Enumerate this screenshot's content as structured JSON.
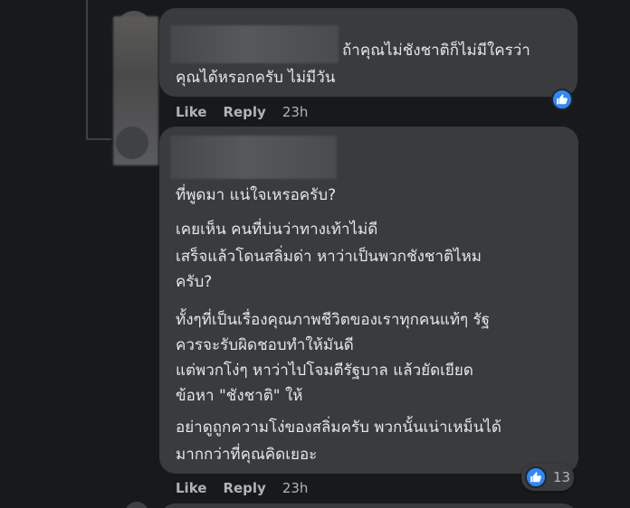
{
  "comment_1": {
    "author_redacted": true,
    "lines": [
      "ถ้าคุณไม่ชังชาติก็ไม่มีใครว่า",
      "คุณได้หรอกครับ ไม่มีวัน"
    ],
    "actions": {
      "like": "Like",
      "reply": "Reply",
      "time": "23h"
    }
  },
  "comment_2": {
    "author_redacted": true,
    "paragraphs": [
      [
        "ที่พูดมา แน่ใจเหรอครับ?"
      ],
      [
        "เคยเห็น คนที่บ่นว่าทางเท้าไม่ดี",
        "เสร็จแล้วโดนสลิ่มด่า หาว่าเป็นพวกชังชาติไหม",
        "ครับ?"
      ],
      [
        "ทั้งๆที่เป็นเรื่องคุณภาพชีวิตของเราทุกคนแท้ๆ รัฐ",
        "ควรจะรับผิดชอบทำให้มันดี",
        "แต่พวกโง่ๆ หาว่าไปโจมตีรัฐบาล แล้วยัดเยียด",
        "ข้อหา \"ชังชาติ\" ให้"
      ],
      [
        "อย่าดูถูกความโง่ของสลิ่มครับ พวกนั้นเน่าเหม็นได้",
        "มากกว่าที่คุณคิดเยอะ"
      ]
    ],
    "reaction_count": "13",
    "actions": {
      "like": "Like",
      "reply": "Reply",
      "time": "23h"
    }
  },
  "colors": {
    "background": "#18191a",
    "bubble": "#3a3b3c",
    "text": "#e4e6eb",
    "meta": "#b0b3b8",
    "like_blue": "#2d88ff"
  },
  "icons": {
    "reaction": "thumbs-up-icon"
  }
}
